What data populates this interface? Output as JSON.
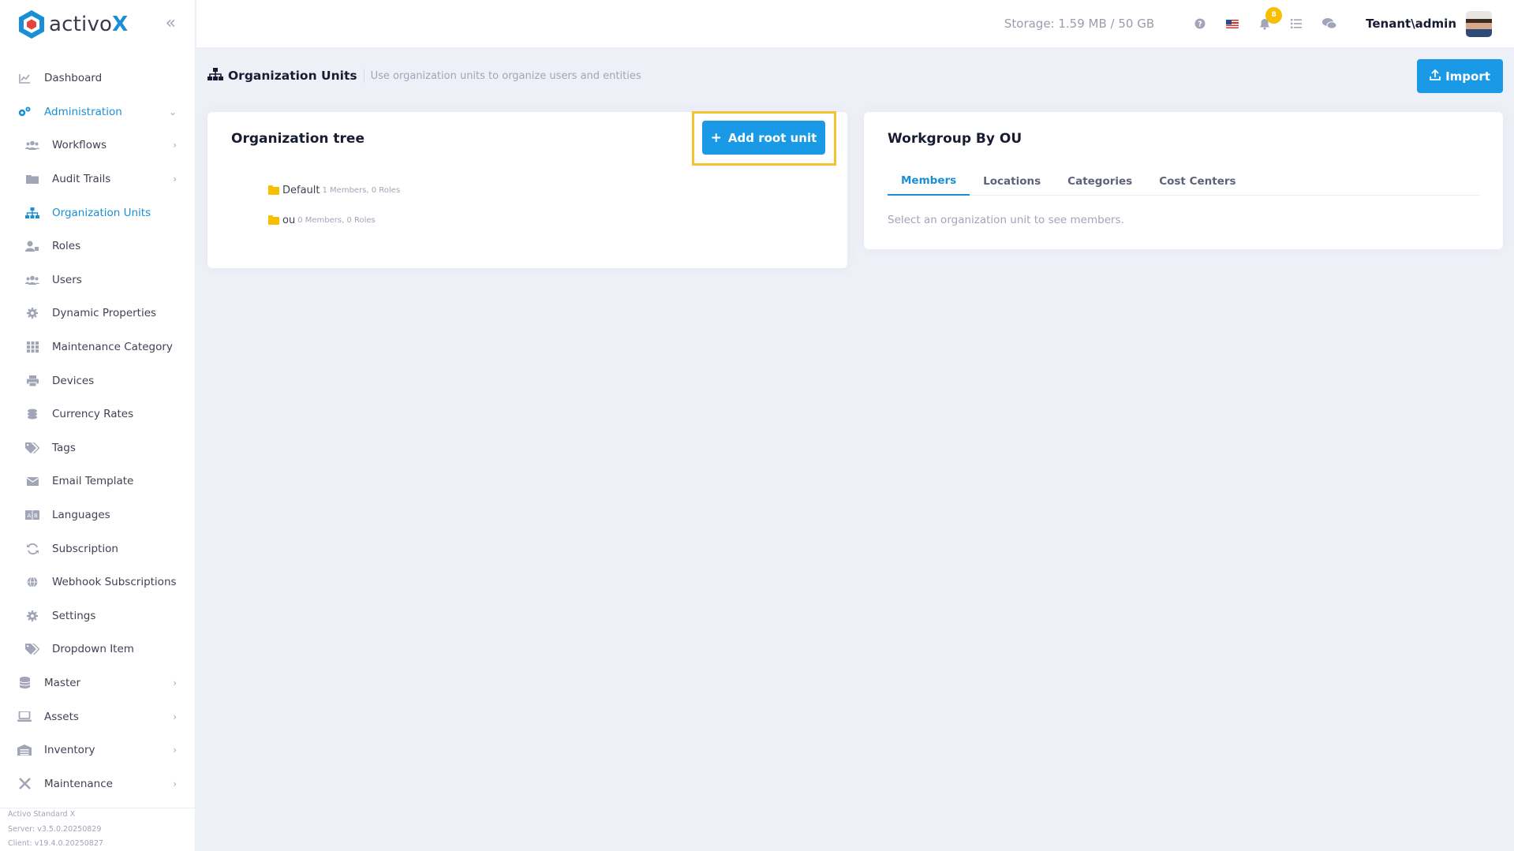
{
  "brand": {
    "prefix": "activo",
    "suffix": "X"
  },
  "header": {
    "storage": "Storage: 1.59 MB / 50 GB",
    "notifications_count": "8",
    "user": "Tenant\\admin"
  },
  "sidebar": {
    "items": [
      {
        "label": "Dashboard",
        "icon": "chart-line-icon"
      },
      {
        "label": "Administration",
        "icon": "cogs-icon",
        "expanded": true
      },
      {
        "label": "Workflows",
        "icon": "users-icon"
      },
      {
        "label": "Audit Trails",
        "icon": "folder-icon"
      },
      {
        "label": "Organization Units",
        "icon": "sitemap-icon",
        "active": true
      },
      {
        "label": "Roles",
        "icon": "user-tag-icon"
      },
      {
        "label": "Users",
        "icon": "users-icon"
      },
      {
        "label": "Dynamic Properties",
        "icon": "gear-icon"
      },
      {
        "label": "Maintenance Category",
        "icon": "grid-icon"
      },
      {
        "label": "Devices",
        "icon": "printer-icon"
      },
      {
        "label": "Currency Rates",
        "icon": "coins-icon"
      },
      {
        "label": "Tags",
        "icon": "tags-icon"
      },
      {
        "label": "Email Template",
        "icon": "envelope-icon"
      },
      {
        "label": "Languages",
        "icon": "language-icon"
      },
      {
        "label": "Subscription",
        "icon": "sync-icon"
      },
      {
        "label": "Webhook Subscriptions",
        "icon": "globe-icon"
      },
      {
        "label": "Settings",
        "icon": "gear-icon"
      },
      {
        "label": "Dropdown Item",
        "icon": "tags-icon"
      },
      {
        "label": "Master",
        "icon": "database-icon"
      },
      {
        "label": "Assets",
        "icon": "laptop-icon"
      },
      {
        "label": "Inventory",
        "icon": "warehouse-icon"
      },
      {
        "label": "Maintenance",
        "icon": "tools-icon"
      }
    ],
    "version": {
      "product": "Activo Standard X",
      "server": "Server: v3.5.0.20250829",
      "client": "Client: v19.4.0.20250827"
    }
  },
  "toolbar": {
    "title": "Organization Units",
    "description": "Use organization units to organize users and entities",
    "import_label": "Import"
  },
  "tree": {
    "title": "Organization tree",
    "add_label": "Add root unit",
    "nodes": [
      {
        "name": "Default",
        "meta": "1 Members, 0 Roles"
      },
      {
        "name": "ou",
        "meta": "0 Members, 0 Roles"
      }
    ]
  },
  "workgroup": {
    "title": "Workgroup By OU",
    "tabs": [
      "Members",
      "Locations",
      "Categories",
      "Cost Centers"
    ],
    "empty_text": "Select an organization unit to see members."
  },
  "colors": {
    "primary": "#1a9ae6",
    "highlight": "#f4c430",
    "badge": "#f6c000"
  }
}
